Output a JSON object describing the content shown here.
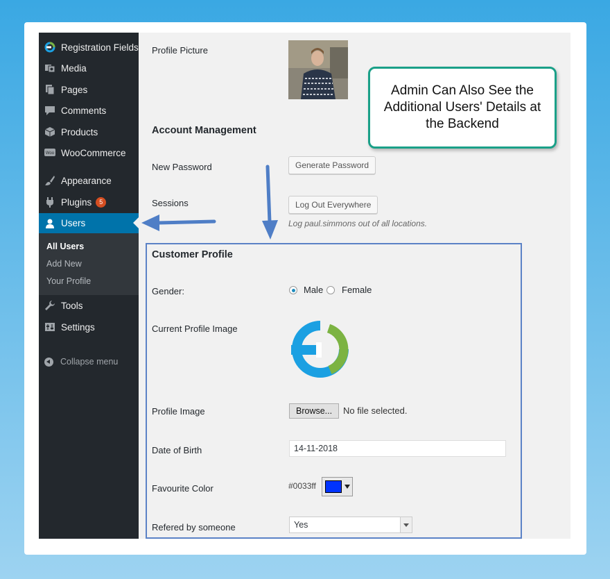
{
  "sidebar": {
    "items": [
      {
        "label": "Registration Fields",
        "icon": "registration-fields-logo-icon"
      },
      {
        "label": "Media",
        "icon": "media-icon"
      },
      {
        "label": "Pages",
        "icon": "pages-icon"
      },
      {
        "label": "Comments",
        "icon": "comments-icon"
      },
      {
        "label": "Products",
        "icon": "products-box-icon"
      },
      {
        "label": "WooCommerce",
        "icon": "woocommerce-icon"
      },
      {
        "label": "Appearance",
        "icon": "appearance-brush-icon"
      },
      {
        "label": "Plugins",
        "icon": "plugins-icon",
        "badge": "5"
      },
      {
        "label": "Users",
        "icon": "users-icon",
        "active": true
      },
      {
        "label": "Tools",
        "icon": "tools-wrench-icon"
      },
      {
        "label": "Settings",
        "icon": "settings-icon"
      }
    ],
    "submenu": [
      "All Users",
      "Add New",
      "Your Profile"
    ],
    "collapse_label": "Collapse menu"
  },
  "profile": {
    "picture_label": "Profile Picture",
    "account_heading": "Account Management",
    "new_password_label": "New Password",
    "generate_password_button": "Generate Password",
    "sessions_label": "Sessions",
    "logout_button": "Log Out Everywhere",
    "logout_desc": "Log paul.simmons out of all locations."
  },
  "customer_profile": {
    "heading": "Customer Profile",
    "gender_label": "Gender:",
    "gender_options": [
      "Male",
      "Female"
    ],
    "gender_selected": "Male",
    "current_image_label": "Current Profile Image",
    "profile_image_label": "Profile Image",
    "browse_button": "Browse...",
    "no_file_text": "No file selected.",
    "dob_label": "Date of Birth",
    "dob_value": "14-11-2018",
    "fav_color_label": "Favourite Color",
    "fav_color_value": "#0033ff",
    "referred_label": "Refered by someone",
    "referred_value": "Yes"
  },
  "callout": {
    "text": "Admin Can Also See the Additional Users' Details at the Backend"
  },
  "colors": {
    "sidebar_bg": "#23282d",
    "active_blue": "#0073aa",
    "callout_border": "#1aa088",
    "highlight_box": "#5b82c6",
    "arrow": "#4f7ec6",
    "badge": "#d54e21"
  }
}
